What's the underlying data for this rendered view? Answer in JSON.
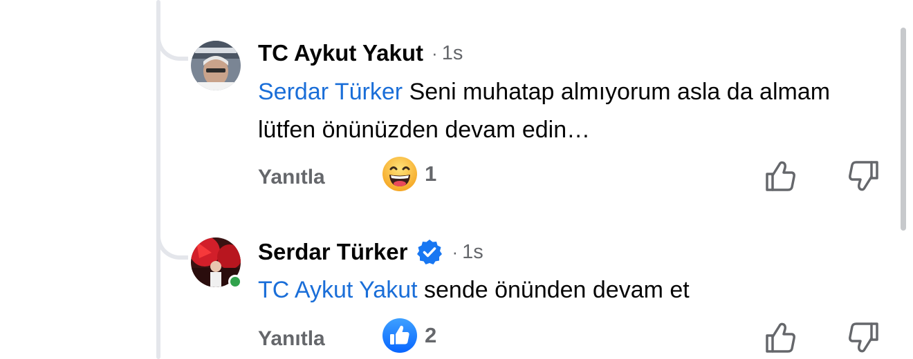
{
  "comments": [
    {
      "author": "TC Aykut Yakut",
      "separator": "·",
      "time": "1s",
      "mention": "Serdar Türker",
      "text": " Seni muhatap almıyorum asla da almam lütfen önünüzden devam edin…",
      "reply_label": "Yanıtla",
      "reaction_icon": "laughing-face-emoji",
      "reaction_count": "1",
      "verified": false,
      "online": false
    },
    {
      "author": "Serdar Türker",
      "separator": "·",
      "time": "1s",
      "mention": "TC Aykut Yakut",
      "text": " sende önünden devam et",
      "reply_label": "Yanıtla",
      "reaction_icon": "thumbs-up-reaction",
      "reaction_count": "2",
      "verified": true,
      "online": true
    }
  ],
  "colors": {
    "mention": "#1a6ed8",
    "secondary_text": "#65676b",
    "verified_badge": "#1877f2",
    "online_indicator": "#31a24c",
    "thread_line": "#e4e6eb"
  }
}
